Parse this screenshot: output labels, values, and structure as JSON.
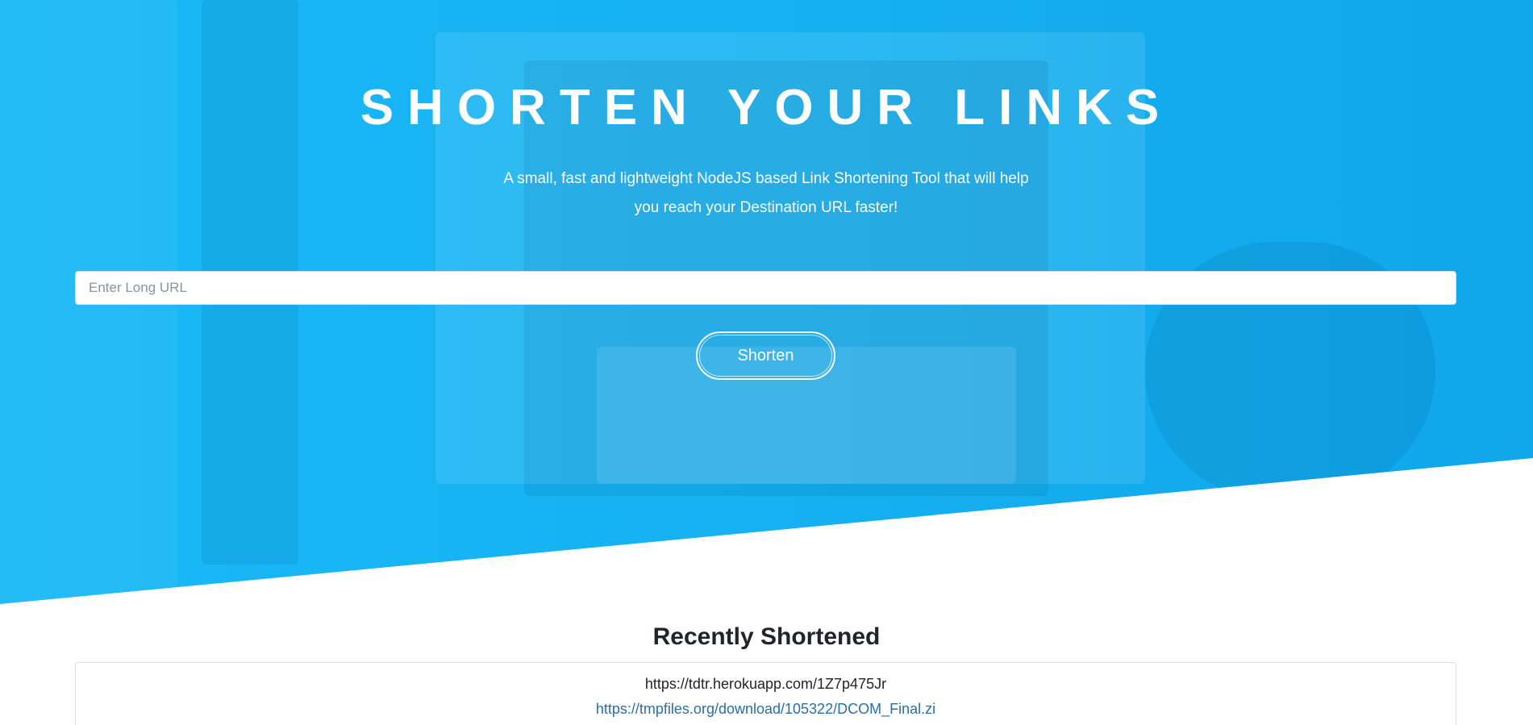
{
  "hero": {
    "title": "SHORTEN YOUR LINKS",
    "subtitle": "A small, fast and lightweight NodeJS based Link Shortening Tool that will help you reach your Destination URL faster!",
    "background_color": "#16b2f2"
  },
  "form": {
    "url_placeholder": "Enter Long URL",
    "url_value": "",
    "shorten_label": "Shorten"
  },
  "recent": {
    "title": "Recently Shortened",
    "items": [
      {
        "short_url": "https://tdtr.herokuapp.com/1Z7p475Jr",
        "long_url": "https://tmpfiles.org/download/105322/DCOM_Final.zi"
      }
    ]
  },
  "colors": {
    "accent": "#16b2f2",
    "link": "#2a6fa8",
    "text_dark": "#212529"
  }
}
